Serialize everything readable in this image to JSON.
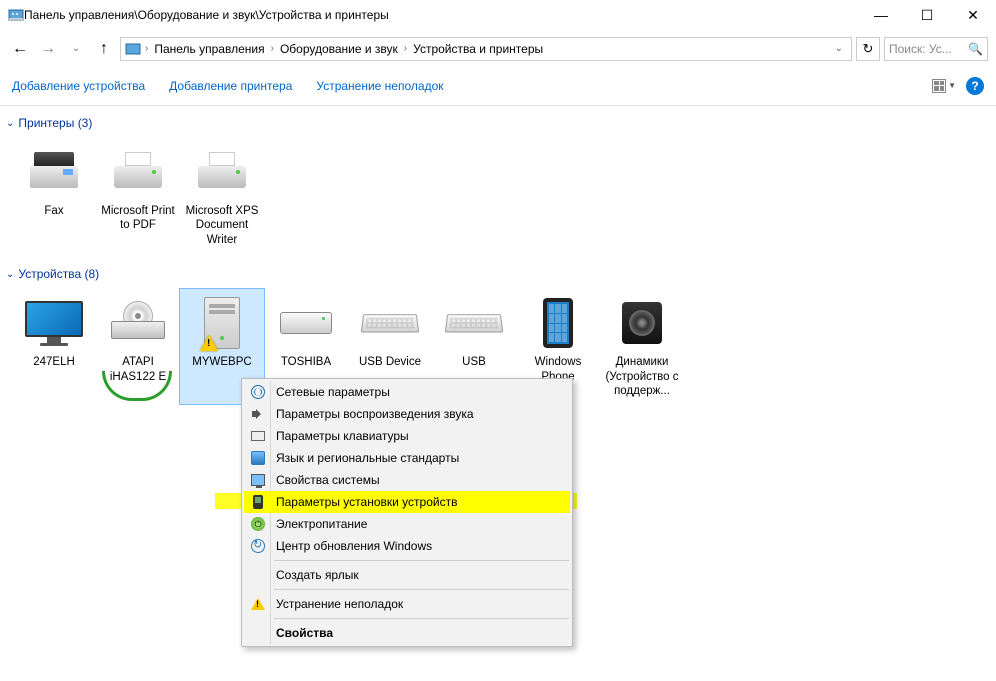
{
  "titlebar": {
    "title": "Панель управления\\Оборудование и звук\\Устройства и принтеры"
  },
  "breadcrumb": {
    "items": [
      "Панель управления",
      "Оборудование и звук",
      "Устройства и принтеры"
    ]
  },
  "search": {
    "placeholder": "Поиск: Ус..."
  },
  "toolbar": {
    "add_device": "Добавление устройства",
    "add_printer": "Добавление принтера",
    "troubleshoot": "Устранение неполадок"
  },
  "groups": {
    "printers": {
      "title": "Принтеры (3)",
      "items": [
        {
          "label": "Fax"
        },
        {
          "label": "Microsoft Print to PDF"
        },
        {
          "label": "Microsoft XPS Document Writer"
        }
      ]
    },
    "devices": {
      "title": "Устройства (8)",
      "items": [
        {
          "label": "247ELH"
        },
        {
          "label": "ATAPI iHAS122   E"
        },
        {
          "label": "MYWEBPC"
        },
        {
          "label": "TOSHIBA"
        },
        {
          "label": "USB Device"
        },
        {
          "label": "USB"
        },
        {
          "label": "Windows Phone"
        },
        {
          "label": "Динамики (Устройство с поддерж..."
        }
      ]
    }
  },
  "context_menu": {
    "items": [
      "Сетевые параметры",
      "Параметры воспроизведения звука",
      "Параметры клавиатуры",
      "Язык и региональные стандарты",
      "Свойства системы",
      "Параметры установки устройств",
      "Электропитание",
      "Центр обновления Windows",
      "Создать ярлык",
      "Устранение неполадок",
      "Свойства"
    ]
  }
}
